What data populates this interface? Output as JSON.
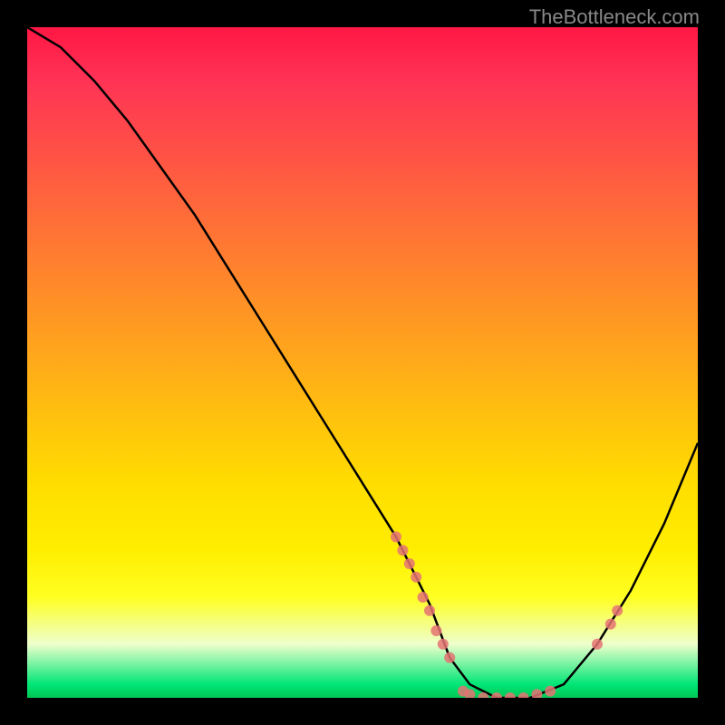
{
  "watermark": "TheBottleneck.com",
  "chart_data": {
    "type": "line",
    "title": "",
    "xlabel": "",
    "ylabel": "",
    "xlim": [
      0,
      100
    ],
    "ylim": [
      0,
      100
    ],
    "curve": {
      "name": "bottleneck-curve",
      "x": [
        0,
        5,
        10,
        15,
        20,
        25,
        30,
        35,
        40,
        45,
        50,
        55,
        60,
        63,
        66,
        70,
        75,
        80,
        85,
        90,
        95,
        100
      ],
      "y": [
        100,
        97,
        92,
        86,
        79,
        72,
        64,
        56,
        48,
        40,
        32,
        24,
        14,
        6,
        2,
        0,
        0,
        2,
        8,
        16,
        26,
        38
      ]
    },
    "markers": [
      {
        "x": 55,
        "y": 24
      },
      {
        "x": 56,
        "y": 22
      },
      {
        "x": 57,
        "y": 20
      },
      {
        "x": 58,
        "y": 18
      },
      {
        "x": 59,
        "y": 15
      },
      {
        "x": 60,
        "y": 13
      },
      {
        "x": 61,
        "y": 10
      },
      {
        "x": 62,
        "y": 8
      },
      {
        "x": 63,
        "y": 6
      },
      {
        "x": 65,
        "y": 1
      },
      {
        "x": 66,
        "y": 0.5
      },
      {
        "x": 68,
        "y": 0
      },
      {
        "x": 70,
        "y": 0
      },
      {
        "x": 72,
        "y": 0
      },
      {
        "x": 74,
        "y": 0
      },
      {
        "x": 76,
        "y": 0.5
      },
      {
        "x": 78,
        "y": 1
      },
      {
        "x": 85,
        "y": 8
      },
      {
        "x": 87,
        "y": 11
      },
      {
        "x": 88,
        "y": 13
      }
    ],
    "gradient_stops": [
      {
        "pos": 0,
        "color": "#ff1744"
      },
      {
        "pos": 50,
        "color": "#ffaa00"
      },
      {
        "pos": 80,
        "color": "#ffee00"
      },
      {
        "pos": 100,
        "color": "#00c853"
      }
    ]
  }
}
